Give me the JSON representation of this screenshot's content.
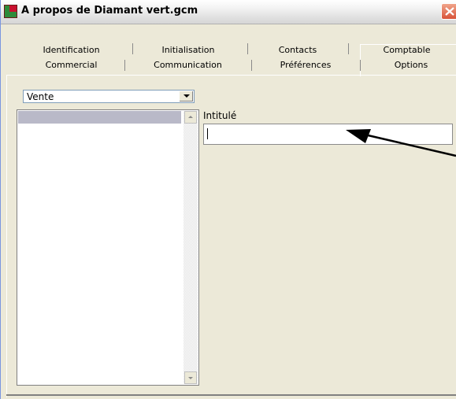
{
  "window": {
    "title": "A propos de Diamant vert.gcm"
  },
  "tabs": {
    "row1": [
      "Identification",
      "Initialisation",
      "Contacts",
      "Comptable"
    ],
    "row2": [
      "Commercial",
      "Communication",
      "Préférences",
      "Options"
    ],
    "active": "Options"
  },
  "options_panel": {
    "category_select": {
      "value": "Vente"
    },
    "list": {
      "items": [
        ""
      ]
    },
    "field_label": "Intitulé",
    "field_value": ""
  },
  "icons": {
    "app": "red-green-app-icon",
    "close": "close-x-icon",
    "annotation": "black-pointer-arrow"
  }
}
